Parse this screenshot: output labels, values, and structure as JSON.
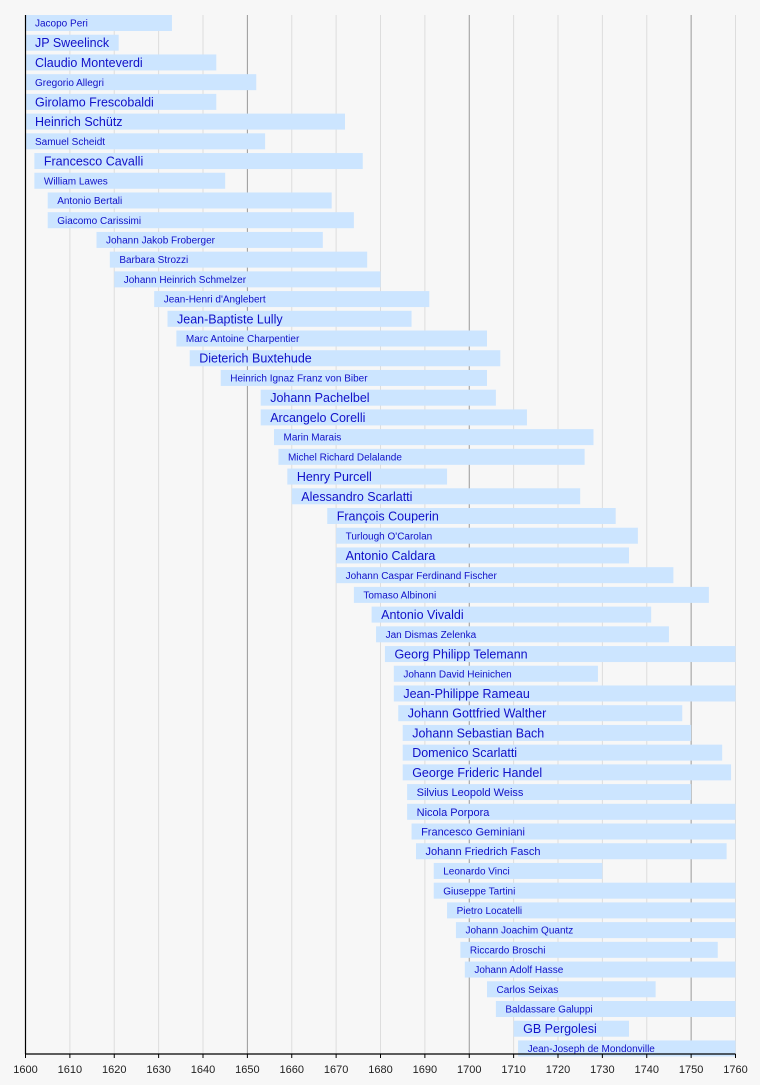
{
  "chart_data": {
    "type": "bar",
    "orientation": "horizontal-timeline",
    "title": "",
    "xlabel": "",
    "ylabel": "",
    "xlim": [
      1600,
      1760
    ],
    "grid": true,
    "major_grid_every": 50,
    "minor_grid_every": 10,
    "x_ticks": [
      1600,
      1610,
      1620,
      1630,
      1640,
      1650,
      1660,
      1670,
      1680,
      1690,
      1700,
      1710,
      1720,
      1730,
      1740,
      1750,
      1760
    ],
    "colors": {
      "bar": "#cce5ff",
      "label": "#1010c8",
      "minor_grid": "#dddddd",
      "major_grid": "#999999",
      "axis": "#000000",
      "background": "#f7f7f7"
    },
    "series": [
      {
        "name": "Jacopo Peri",
        "start": 1600,
        "end": 1633,
        "emphasis": "small"
      },
      {
        "name": "JP Sweelinck",
        "start": 1600,
        "end": 1621,
        "emphasis": "large"
      },
      {
        "name": "Claudio Monteverdi",
        "start": 1600,
        "end": 1643,
        "emphasis": "large"
      },
      {
        "name": "Gregorio Allegri",
        "start": 1600,
        "end": 1652,
        "emphasis": "small"
      },
      {
        "name": "Girolamo Frescobaldi",
        "start": 1600,
        "end": 1643,
        "emphasis": "large"
      },
      {
        "name": "Heinrich Schütz",
        "start": 1600,
        "end": 1672,
        "emphasis": "large"
      },
      {
        "name": "Samuel Scheidt",
        "start": 1600,
        "end": 1654,
        "emphasis": "small"
      },
      {
        "name": "Francesco Cavalli",
        "start": 1602,
        "end": 1676,
        "emphasis": "large"
      },
      {
        "name": "William Lawes",
        "start": 1602,
        "end": 1645,
        "emphasis": "small"
      },
      {
        "name": "Antonio Bertali",
        "start": 1605,
        "end": 1669,
        "emphasis": "small"
      },
      {
        "name": "Giacomo Carissimi",
        "start": 1605,
        "end": 1674,
        "emphasis": "small"
      },
      {
        "name": "Johann Jakob Froberger",
        "start": 1616,
        "end": 1667,
        "emphasis": "small"
      },
      {
        "name": "Barbara Strozzi",
        "start": 1619,
        "end": 1677,
        "emphasis": "small"
      },
      {
        "name": "Johann Heinrich Schmelzer",
        "start": 1620,
        "end": 1680,
        "emphasis": "small"
      },
      {
        "name": "Jean-Henri d'Anglebert",
        "start": 1629,
        "end": 1691,
        "emphasis": "small"
      },
      {
        "name": "Jean-Baptiste Lully",
        "start": 1632,
        "end": 1687,
        "emphasis": "large"
      },
      {
        "name": "Marc Antoine Charpentier",
        "start": 1634,
        "end": 1704,
        "emphasis": "small"
      },
      {
        "name": "Dieterich Buxtehude",
        "start": 1637,
        "end": 1707,
        "emphasis": "large"
      },
      {
        "name": "Heinrich Ignaz Franz von Biber",
        "start": 1644,
        "end": 1704,
        "emphasis": "small"
      },
      {
        "name": "Johann Pachelbel",
        "start": 1653,
        "end": 1706,
        "emphasis": "large"
      },
      {
        "name": "Arcangelo Corelli",
        "start": 1653,
        "end": 1713,
        "emphasis": "large"
      },
      {
        "name": "Marin Marais",
        "start": 1656,
        "end": 1728,
        "emphasis": "small"
      },
      {
        "name": "Michel Richard Delalande",
        "start": 1657,
        "end": 1726,
        "emphasis": "small"
      },
      {
        "name": "Henry Purcell",
        "start": 1659,
        "end": 1695,
        "emphasis": "large"
      },
      {
        "name": "Alessandro Scarlatti",
        "start": 1660,
        "end": 1725,
        "emphasis": "large"
      },
      {
        "name": "François Couperin",
        "start": 1668,
        "end": 1733,
        "emphasis": "large"
      },
      {
        "name": "Turlough O'Carolan",
        "start": 1670,
        "end": 1738,
        "emphasis": "small"
      },
      {
        "name": "Antonio Caldara",
        "start": 1670,
        "end": 1736,
        "emphasis": "large"
      },
      {
        "name": "Johann Caspar Ferdinand Fischer",
        "start": 1670,
        "end": 1746,
        "emphasis": "small"
      },
      {
        "name": "Tomaso Albinoni",
        "start": 1674,
        "end": 1754,
        "emphasis": "small"
      },
      {
        "name": "Antonio Vivaldi",
        "start": 1678,
        "end": 1741,
        "emphasis": "large"
      },
      {
        "name": "Jan Dismas Zelenka",
        "start": 1679,
        "end": 1745,
        "emphasis": "small"
      },
      {
        "name": "Georg Philipp Telemann",
        "start": 1681,
        "end": 1760,
        "emphasis": "large"
      },
      {
        "name": "Johann David Heinichen",
        "start": 1683,
        "end": 1729,
        "emphasis": "small"
      },
      {
        "name": "Jean-Philippe Rameau",
        "start": 1683,
        "end": 1760,
        "emphasis": "large"
      },
      {
        "name": "Johann Gottfried Walther",
        "start": 1684,
        "end": 1748,
        "emphasis": "large"
      },
      {
        "name": "Johann Sebastian Bach",
        "start": 1685,
        "end": 1750,
        "emphasis": "large"
      },
      {
        "name": "Domenico Scarlatti",
        "start": 1685,
        "end": 1757,
        "emphasis": "large"
      },
      {
        "name": "George Frideric Handel",
        "start": 1685,
        "end": 1759,
        "emphasis": "large"
      },
      {
        "name": "Silvius Leopold Weiss",
        "start": 1686,
        "end": 1750,
        "emphasis": "medium"
      },
      {
        "name": "Nicola Porpora",
        "start": 1686,
        "end": 1760,
        "emphasis": "medium"
      },
      {
        "name": "Francesco Geminiani",
        "start": 1687,
        "end": 1760,
        "emphasis": "medium"
      },
      {
        "name": "Johann Friedrich Fasch",
        "start": 1688,
        "end": 1758,
        "emphasis": "medium"
      },
      {
        "name": "Leonardo Vinci",
        "start": 1692,
        "end": 1730,
        "emphasis": "small"
      },
      {
        "name": "Giuseppe Tartini",
        "start": 1692,
        "end": 1760,
        "emphasis": "small"
      },
      {
        "name": "Pietro Locatelli",
        "start": 1695,
        "end": 1760,
        "emphasis": "small"
      },
      {
        "name": "Johann Joachim Quantz",
        "start": 1697,
        "end": 1760,
        "emphasis": "small"
      },
      {
        "name": "Riccardo Broschi",
        "start": 1698,
        "end": 1756,
        "emphasis": "small"
      },
      {
        "name": "Johann Adolf Hasse",
        "start": 1699,
        "end": 1760,
        "emphasis": "small"
      },
      {
        "name": "Carlos Seixas",
        "start": 1704,
        "end": 1742,
        "emphasis": "small"
      },
      {
        "name": "Baldassare Galuppi",
        "start": 1706,
        "end": 1760,
        "emphasis": "small"
      },
      {
        "name": "GB Pergolesi",
        "start": 1710,
        "end": 1736,
        "emphasis": "large"
      },
      {
        "name": "Jean-Joseph de Mondonville",
        "start": 1711,
        "end": 1760,
        "emphasis": "small"
      }
    ]
  }
}
